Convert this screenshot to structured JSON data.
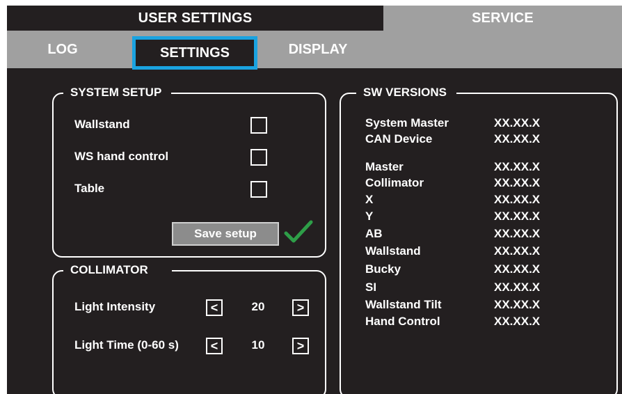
{
  "top_tabs": {
    "user_settings": "USER SETTINGS",
    "service": "SERVICE"
  },
  "sub_tabs": {
    "log": "LOG",
    "settings": "SETTINGS",
    "display": "DISPLAY",
    "active": "SETTINGS"
  },
  "system_setup": {
    "title": "SYSTEM SETUP",
    "items": [
      {
        "label": "Wallstand",
        "checked": false
      },
      {
        "label": "WS hand control",
        "checked": false
      },
      {
        "label": "Table",
        "checked": false
      }
    ],
    "save_label": "Save setup",
    "saved_icon": "checkmark-icon"
  },
  "collimator": {
    "title": "COLLIMATOR",
    "light_intensity": {
      "label": "Light Intensity",
      "value": "20"
    },
    "light_time": {
      "label": "Light Time (0-60 s)",
      "value": "10"
    },
    "decrease_glyph": "<",
    "increase_glyph": ">"
  },
  "sw_versions": {
    "title": "SW VERSIONS",
    "rows": [
      {
        "name": "System Master",
        "version": "XX.XX.X"
      },
      {
        "name": "CAN Device",
        "version": "XX.XX.X"
      },
      {
        "name": "Master",
        "version": "XX.XX.X"
      },
      {
        "name": "Collimator",
        "version": "XX.XX.X"
      },
      {
        "name": "X",
        "version": "XX.XX.X"
      },
      {
        "name": "Y",
        "version": "XX.XX.X"
      },
      {
        "name": "AB",
        "version": "XX.XX.X"
      },
      {
        "name": "Wallstand",
        "version": "XX.XX.X"
      },
      {
        "name": "Bucky",
        "version": "XX.XX.X"
      },
      {
        "name": "SI",
        "version": "XX.XX.X"
      },
      {
        "name": "Wallstand Tilt",
        "version": "XX.XX.X"
      },
      {
        "name": "Hand Control",
        "version": "XX.XX.X"
      }
    ]
  },
  "colors": {
    "background": "#231f20",
    "tab_inactive": "#a0a0a0",
    "active_tab_border": "#1aa3e0",
    "check_green": "#2e9e48",
    "text": "#ffffff"
  }
}
